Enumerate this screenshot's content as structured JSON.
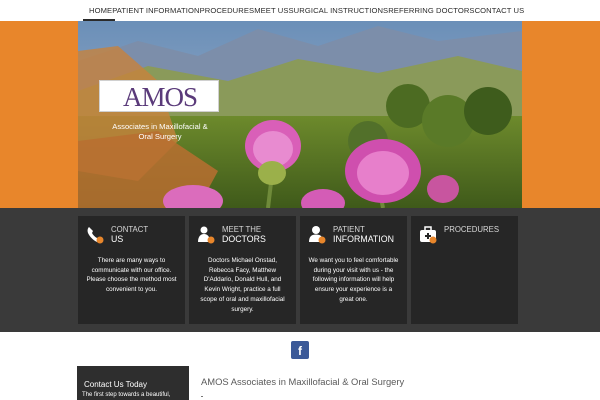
{
  "nav": {
    "items": [
      {
        "label": "HOME"
      },
      {
        "label": "PATIENT INFORMATION"
      },
      {
        "label": "PROCEDURES"
      },
      {
        "label": "MEET US"
      },
      {
        "label": "SURGICAL INSTRUCTIONS"
      },
      {
        "label": "REFERRING DOCTORS"
      },
      {
        "label": "CONTACT US"
      }
    ],
    "active_index": 0
  },
  "hero": {
    "logo_text": "AMOS",
    "tagline_line1": "Associates in Maxillofacial &",
    "tagline_line2": "Oral Surgery"
  },
  "cards": [
    {
      "icon": "phone-icon",
      "title1": "CONTACT",
      "title2": "US",
      "body": "There are many ways to communicate with our office. Please choose the method most convenient to you."
    },
    {
      "icon": "doctors-icon",
      "title1": "MEET THE",
      "title2": "DOCTORS",
      "body": "Doctors Michael Onstad, Rebecca Facy, Matthew D'Addario, Donald Hull, and Kevin Wright, practice a full scope of oral and maxillofacial surgery."
    },
    {
      "icon": "patient-icon",
      "title1": "PATIENT",
      "title2": "INFORMATION",
      "body": "We want you to feel comfortable during your visit with us - the following information will help ensure your experience is a great one."
    },
    {
      "icon": "medical-kit-icon",
      "title1": "PROCEDURES",
      "title2": "",
      "body": ""
    }
  ],
  "social": {
    "facebook_label": "f"
  },
  "contact_box": {
    "title": "Contact Us Today",
    "sub": "The first step towards a beautiful,"
  },
  "main": {
    "heading": "AMOS Associates in Maxillofacial & Oral Surgery"
  },
  "colors": {
    "orange": "#e8862b",
    "dark_band": "#3a3a3a",
    "card": "#262626",
    "facebook": "#3b5998",
    "logo": "#5a3a7a"
  }
}
